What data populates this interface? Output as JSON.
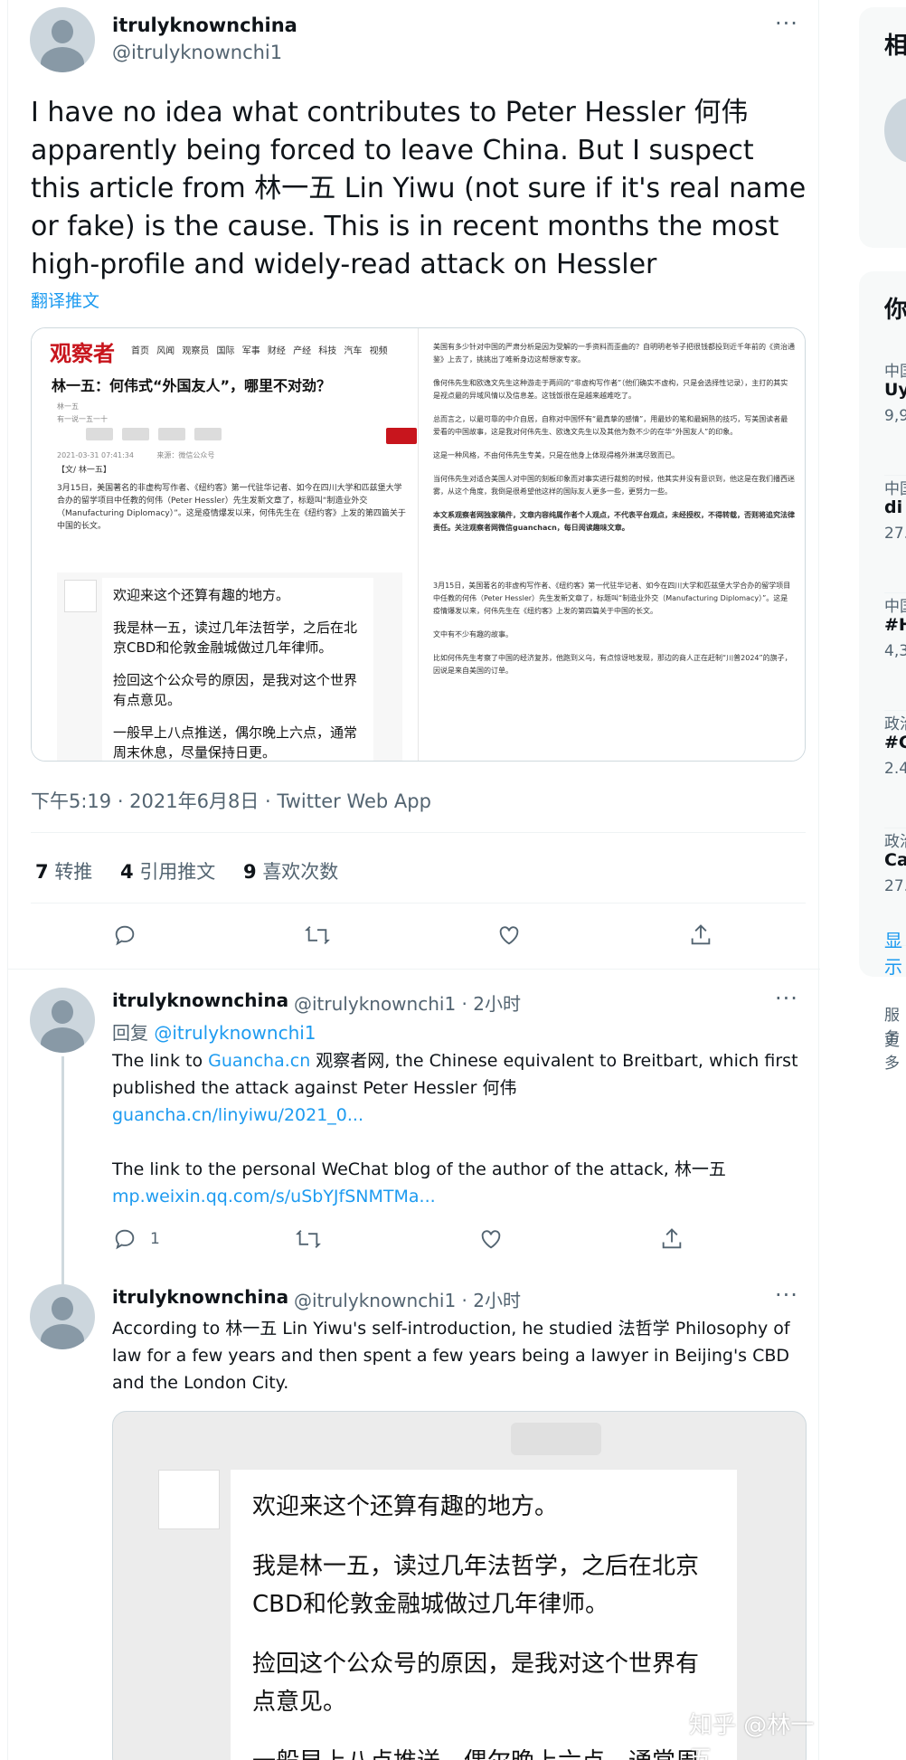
{
  "main_tweet": {
    "display_name": "itrulyknownchina",
    "handle": "@itrulyknownchi1",
    "more": "···",
    "text": "I have no idea what contributes to Peter Hessler 何伟 apparently being forced to leave China. But I suspect this article from 林一五 Lin Yiwu (not sure if it's real name or fake) is the cause. This is in recent months the most high-profile and widely-read attack on Hessler",
    "translate": "翻译推文",
    "timestamp": "下午5:19 · 2021年6月8日 · Twitter Web App",
    "stats": {
      "retweets_count": "7",
      "retweets_label": "转推",
      "quotes_count": "4",
      "quotes_label": "引用推文",
      "likes_count": "9",
      "likes_label": "喜欢次数"
    }
  },
  "media": {
    "left": {
      "logo": "观察者",
      "nav": "首页 风闻 观察员 国际 军事 财经 产经 科技 汽车 视频",
      "title": "林一五：何伟式“外国友人”，哪里不对劲？",
      "meta_author": "林一五",
      "meta_sub": "有一说一五一十",
      "meta_date": "2021-03-31 07:41:34",
      "meta_source": "来源：微信公众号",
      "byline": "【文/ 林一五】",
      "body": "3月15日，美国著名的非虚构写作者、《纽约客》第一代驻华记者、如今在四川大学和匹兹堡大学合办的留学项目中任教的何伟（Peter Hessler）先生发新文章了，标题叫“制造业外交（Manufacturing Diplomacy）”。这是疫情爆发以来，何伟先生在《纽约客》上发的第四篇关于中国的长文。",
      "wechat": [
        "欢迎来这个还算有趣的地方。",
        "我是林一五，读过几年法哲学，之后在北京CBD和伦敦金融城做过几年律师。",
        "捡回这个公众号的原因，是我对这个世界有点意见。",
        "一般早上八点推送，偶尔晚上六点，通常周末休息，尽量保持日更。"
      ]
    },
    "right": {
      "paragraphs": [
        "美国有多少针对中国的严肃分析是因为受解的一手资料而歪曲的？自明明老爷子把很钱都投到近千年前的《资治通鉴》上去了，挑挑出了唯新身边这帮想家专家。",
        "像何伟先生和欧逸文先生这种游走于两间的“非虚构写作者”（他们确实不虚构，只是会选择性记录），主打的其实是视点最的异域风情以及信息差。这钱饭很在是越来越难吃了。",
        "总而言之，以最可靠的中介自居，自称对中国怀有“最真挚的感情”，用最妙的笔和最娴熟的技巧，写美国读者最爱看的中国故事，这是我对何伟先生、欧逸文先生以及其他为数不少的在华“外国友人”的印象。",
        "这是一种风格，不由何伟先生专美，只是在他身上体现得格外淋漓尽致而已。",
        "当何伟先生对适合美国人对中国的刻板印象而对事实进行裁剪的时候，他其实并没有意识到，他这是在我们播西迷雾，从这个角度，我倒是很希望他这样的国际友人更多一些，更努力一些。",
        "本文系观察者网独家稿件，文章内容纯属作者个人观点，不代表平台观点，未经授权，不得转载，否则将追究法律责任。关注观察者网微信guanchacn，每日阅读趣味文章。",
        "3月15日，美国著名的非虚构写作者、《纽约客》第一代驻华记者、如今在四川大学和匹兹堡大学合办的留学项目中任教的何伟（Peter Hessler）先生发新文章了，标题叫“制造业外交（Manufacturing Diplomacy）”。这是疫情爆发以来，何伟先生在《纽约客》上发的第四篇关于中国的长文。",
        "文中有不少有趣的故事。",
        "比如何伟先生考察了中国的经济复苏，他跑到义乌，有点惊讶地发现，那边的商人正在赶制“川普2024”的旗子，因说是来自美国的订单。"
      ]
    }
  },
  "reply1": {
    "display_name": "itrulyknownchina",
    "meta": "@itrulyknownchi1 · 2小时",
    "more": "···",
    "reply_label": "回复",
    "reply_to": "@itrulyknownchi1",
    "text1_pre": "The link to ",
    "text1_link": "Guancha.cn",
    "text1_post": " 观察者网, the Chinese equivalent to Breitbart, which first published the attack against Peter Hessler 何伟",
    "link1": "guancha.cn/linyiwu/2021_0...",
    "text2": "The link to the personal WeChat blog of the author of the attack, 林一五",
    "link2": "mp.weixin.qq.com/s/uSbYJfSNMTMa...",
    "reply_count": "1"
  },
  "reply2": {
    "display_name": "itrulyknownchina",
    "meta": "@itrulyknownchi1 · 2小时",
    "more": "···",
    "text": "According to 林一五 Lin Yiwu's self-introduction, he studied 法哲学 Philosophy of law for a few years and then spent a few years being a lawyer in Beijing's CBD and the London City.",
    "image_lines": [
      "欢迎来这个还算有趣的地方。",
      "我是林一五，读过几年法哲学，之后在北京CBD和伦敦金融城做过几年律师。",
      "捡回这个公众号的原因，是我对这个世界有点意见。",
      "一般早上八点推送，偶尔晚上六点，通常周"
    ]
  },
  "watermark": "知乎 @林一五",
  "right_column": {
    "box1_head": "相",
    "box2_head": "你",
    "trends": [
      {
        "cat": "中国",
        "title": "Uy",
        "count": "9,9"
      },
      {
        "cat": "中国",
        "title": "di",
        "count": "27."
      },
      {
        "cat": "中国",
        "title": "#H",
        "count": "4,3"
      },
      {
        "cat": "政治",
        "title": "#C",
        "count": "2.4"
      },
      {
        "cat": "政治",
        "title": "Ca",
        "count": "27."
      }
    ],
    "show_more": "显示",
    "footer1": "服务",
    "footer2": "更多"
  }
}
